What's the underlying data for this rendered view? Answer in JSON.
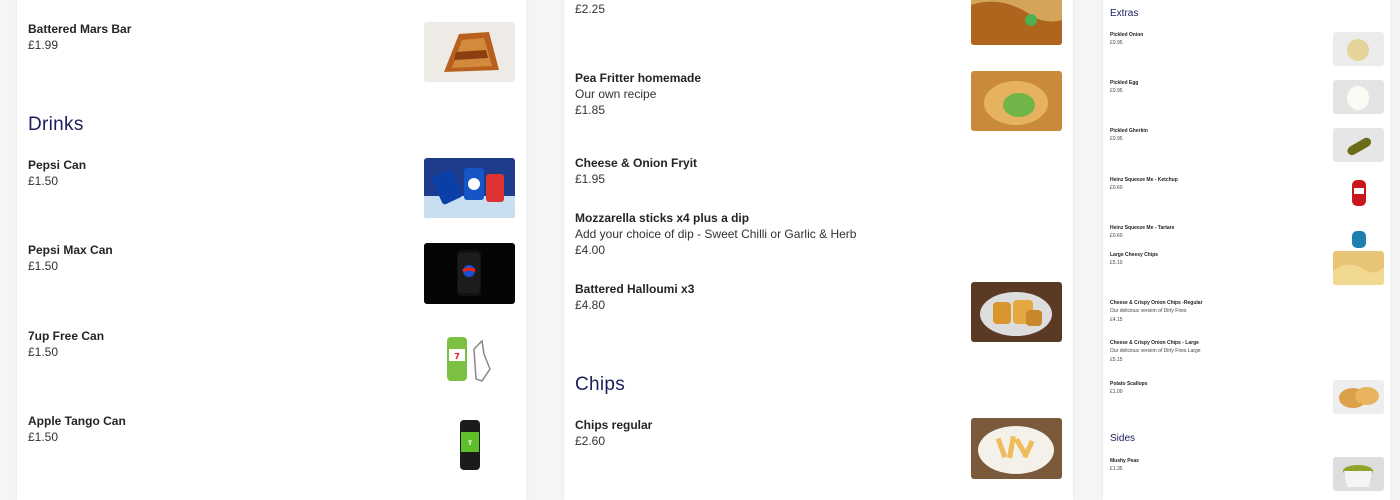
{
  "panel1": {
    "items_top": [
      {
        "name": "Battered Mars Bar",
        "price": "£1.99"
      }
    ],
    "drinks_title": "Drinks",
    "drinks": [
      {
        "name": "Pepsi Can",
        "price": "£1.50"
      },
      {
        "name": "Pepsi Max Can",
        "price": "£1.50"
      },
      {
        "name": "7up Free Can",
        "price": "£1.50"
      },
      {
        "name": "Apple Tango Can",
        "price": "£1.50"
      }
    ]
  },
  "panel2": {
    "top_price": "£2.25",
    "items": [
      {
        "name": "Pea Fritter homemade",
        "desc": "Our own recipe",
        "price": "£1.85"
      },
      {
        "name": "Cheese & Onion Fryit",
        "price": "£1.95"
      },
      {
        "name": "Mozzarella sticks x4 plus a dip",
        "desc": "Add your choice of dip - Sweet Chilli or Garlic & Herb",
        "price": "£4.00"
      },
      {
        "name": "Battered Halloumi x3",
        "price": "£4.80"
      }
    ],
    "chips_title": "Chips",
    "chips": [
      {
        "name": "Chips regular",
        "price": "£2.60"
      }
    ]
  },
  "panel3": {
    "extras_title": "Extras",
    "extras": [
      {
        "name": "Pickled Onion",
        "price": "£0.95"
      },
      {
        "name": "Pickled Egg",
        "price": "£0.95"
      },
      {
        "name": "Pickled Gherkin",
        "price": "£0.95"
      },
      {
        "name": "Heinz Squeeze Me - Ketchup",
        "price": "£0.60"
      },
      {
        "name": "Heinz Squeeze Me - Tartare",
        "price": "£0.60"
      },
      {
        "name": "Large Cheesy Chips",
        "price": "£5.10"
      },
      {
        "name": "Cheese & Crispy Onion Chips -Regular",
        "desc": "Our delicious version of Dirty Fries",
        "price": "£4.15"
      },
      {
        "name": "Cheese & Crispy Onion Chips - Large",
        "desc": "Our delicious version of Dirty Fries Large",
        "price": "£5.15"
      },
      {
        "name": "Potato Scallops",
        "price": "£1.00"
      }
    ],
    "sides_title": "Sides",
    "sides": [
      {
        "name": "Mushy Peas",
        "price": "£1.35"
      }
    ]
  },
  "colors": {
    "section_title": "#1a1f5a",
    "background": "#f5f5f5"
  }
}
